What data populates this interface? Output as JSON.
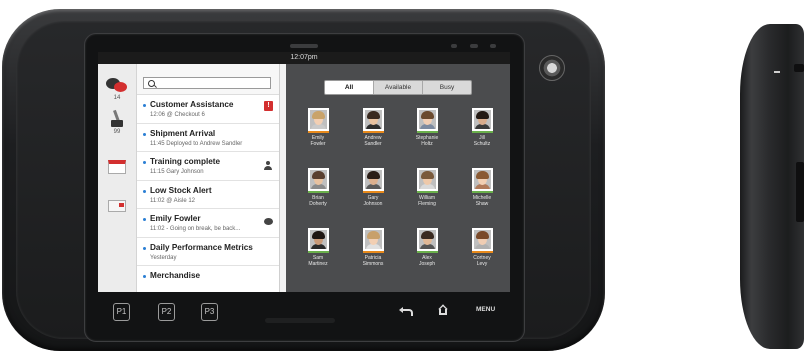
{
  "status_bar": {
    "time": "12:07pm"
  },
  "rail": {
    "items": [
      {
        "icon": "chat-icon",
        "count": "14"
      },
      {
        "icon": "tool-icon",
        "count": "99"
      },
      {
        "icon": "calendar-icon",
        "count": ""
      },
      {
        "icon": "card-icon",
        "count": ""
      }
    ]
  },
  "search": {
    "placeholder": "",
    "value": ""
  },
  "list": {
    "items": [
      {
        "title": "Customer Assistance",
        "sub": "12:06  @ Checkout 6",
        "badge": "!"
      },
      {
        "title": "Shipment Arrival",
        "sub": "11:45 Deployed to Andrew Sandler"
      },
      {
        "title": "Training complete",
        "sub": "11:15 Gary Johnson"
      },
      {
        "title": "Low Stock Alert",
        "sub": "11:02  @ Aisle 12"
      },
      {
        "title": "Emily  Fowler",
        "sub": "11:02 - Going on break, be back..."
      },
      {
        "title": "Daily Performance Metrics",
        "sub": "Yesterday"
      },
      {
        "title": "Merchandise",
        "sub": ""
      }
    ]
  },
  "filter": {
    "tabs": [
      "All",
      "Available",
      "Busy"
    ],
    "selected": "All"
  },
  "contacts": [
    {
      "first": "Emily",
      "last": "Fowler",
      "status": "#e88a1c",
      "hair": "#c9a36a",
      "skin": "#f2cfb3",
      "shirt": "#c9c9c9"
    },
    {
      "first": "Andrew",
      "last": "Sandler",
      "status": "#e88a1c",
      "hair": "#3a2a20",
      "skin": "#e8c2a0",
      "shirt": "#2e2e2e"
    },
    {
      "first": "Stephanie",
      "last": "Holtz",
      "status": "#6ab04c",
      "hair": "#6b4a2e",
      "skin": "#f0cdb3",
      "shirt": "#7c8aa0"
    },
    {
      "first": "Jill",
      "last": "Schultz",
      "status": "#6ab04c",
      "hair": "#241a14",
      "skin": "#d9ac8c",
      "shirt": "#3b3b3b"
    },
    {
      "first": "Brian",
      "last": "Doherty",
      "status": "#6ab04c",
      "hair": "#5a4030",
      "skin": "#e8c2a0",
      "shirt": "#8b8b8b"
    },
    {
      "first": "Gary",
      "last": "Johnson",
      "status": "#e88a1c",
      "hair": "#2a1d16",
      "skin": "#dcb08e",
      "shirt": "#5a5a5a"
    },
    {
      "first": "William",
      "last": "Fleming",
      "status": "#6ab04c",
      "hair": "#7a5a3c",
      "skin": "#eec9aa",
      "shirt": "#d9d9d9"
    },
    {
      "first": "Michelle",
      "last": "Shaw",
      "status": "#6ab04c",
      "hair": "#8a5a34",
      "skin": "#f2cfb3",
      "shirt": "#b07a5a"
    },
    {
      "first": "Sam",
      "last": "Martinez",
      "status": "#6ab04c",
      "hair": "#1e1612",
      "skin": "#c99a78",
      "shirt": "#2a2a2a"
    },
    {
      "first": "Patricia",
      "last": "Simmons",
      "status": "#e88a1c",
      "hair": "#c8a06a",
      "skin": "#f2cfb3",
      "shirt": "#e0e0e0"
    },
    {
      "first": "Alex",
      "last": "Joseph",
      "status": "#6ab04c",
      "hair": "#3a2a20",
      "skin": "#e0b896",
      "shirt": "#555555"
    },
    {
      "first": "Cortney",
      "last": "Levy",
      "status": "#e88a1c",
      "hair": "#7a4a2a",
      "skin": "#f0cdb3",
      "shirt": "#b0b0b0"
    }
  ],
  "hardware": {
    "buttons": [
      "P1",
      "P2",
      "P3"
    ],
    "back_icon": "back-arrow-icon",
    "home_icon": "home-icon",
    "menu_label": "MENU"
  }
}
